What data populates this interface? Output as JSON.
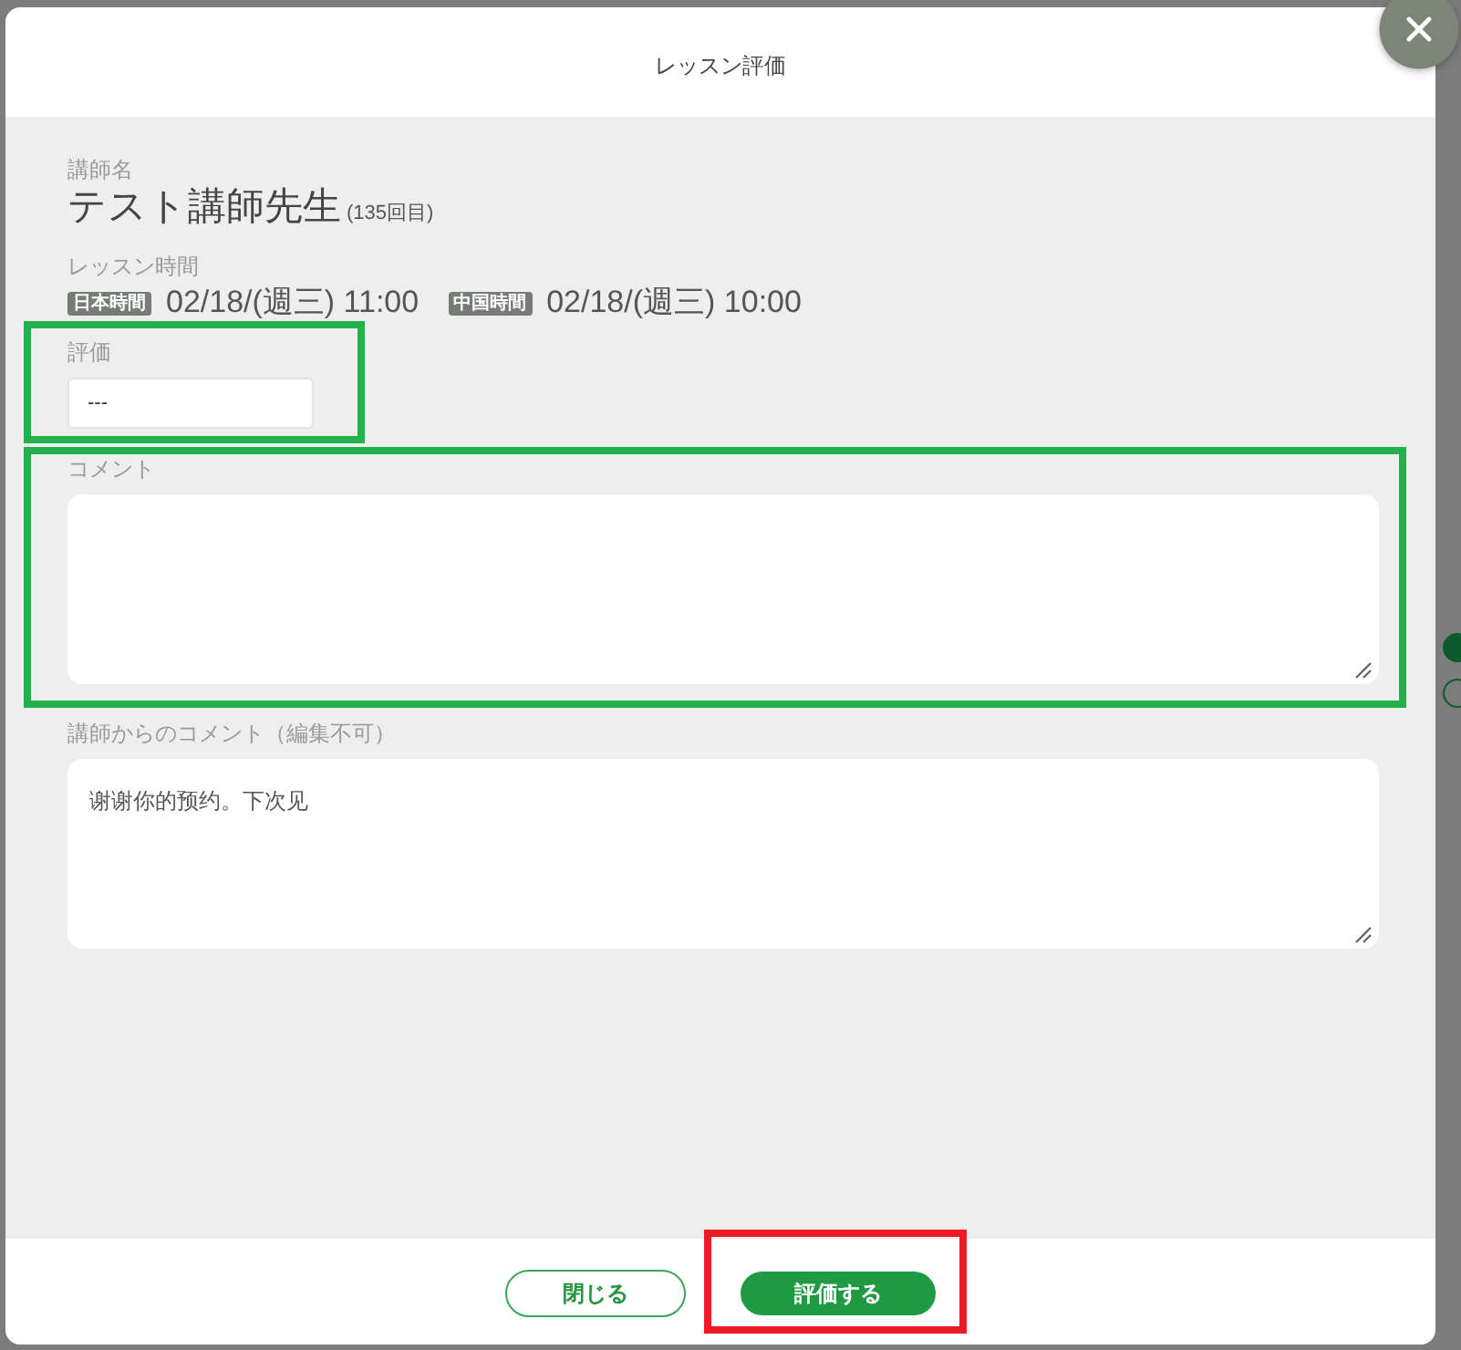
{
  "dialog": {
    "title": "レッスン評価"
  },
  "teacher": {
    "label": "講師名",
    "name": "テスト講師先生",
    "lesson_count": "(135回目)"
  },
  "lesson_time": {
    "label": "レッスン時間",
    "times": [
      {
        "zone": "日本時間",
        "value": "02/18/(週三) 11:00"
      },
      {
        "zone": "中国時間",
        "value": "02/18/(週三) 10:00"
      }
    ]
  },
  "fields": [
    {
      "kind": "select",
      "label": "評価",
      "value": "---",
      "highlight": {
        "color": "#22b14c"
      }
    },
    {
      "kind": "textarea",
      "label": "コメント",
      "highlight": {
        "color": "#22b14c"
      }
    },
    {
      "kind": "readonly",
      "label": "講師からのコメント（編集不可）",
      "value": "谢谢你的预约。下次见"
    }
  ],
  "buttons": [
    {
      "kind": "outline",
      "label": "閉じる"
    },
    {
      "kind": "primary",
      "label": "評価する",
      "highlight": {
        "color": "#ed1c24"
      }
    }
  ]
}
